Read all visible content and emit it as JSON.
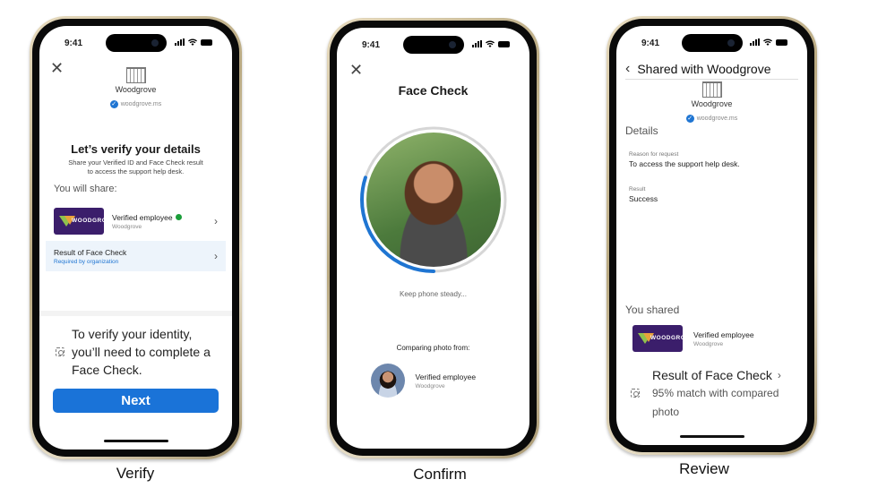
{
  "status_bar": {
    "time": "9:41"
  },
  "org": {
    "name": "Woodgrove",
    "domain": "woodgrove.ms",
    "card_text": "WOODGROVE"
  },
  "colors": {
    "accent": "#1a73d8",
    "progress": "#1f75d2",
    "card_bg": "#3b1e6b",
    "verified_green": "#1a9e3a",
    "highlight_row": "#edf4fb"
  },
  "steps": [
    {
      "label": "Verify"
    },
    {
      "label": "Confirm"
    },
    {
      "label": "Review"
    }
  ],
  "verify": {
    "close_icon": "close-icon",
    "title": "Let’s verify your details",
    "subtitle": "Share your Verified ID and Face Check result to access the support help desk.",
    "share_heading": "You will share:",
    "credential": {
      "name": "Verified employee",
      "issuer": "Woodgrove"
    },
    "face_check_row": {
      "title": "Result of Face Check",
      "subtitle": "Required by organization"
    },
    "sheet_message": "To verify your identity, you’ll need to complete a Face Check.",
    "next_label": "Next"
  },
  "confirm": {
    "title": "Face Check",
    "progress_fraction": 0.3,
    "status": "Keep phone steady...",
    "comparing_label": "Comparing photo from:",
    "credential": {
      "name": "Verified employee",
      "issuer": "Woodgrove"
    }
  },
  "review": {
    "back_icon": "chevron-left-icon",
    "title": "Shared with Woodgrove",
    "details_heading": "Details",
    "fields": [
      {
        "key": "Reason for request",
        "value": "To access the support help desk."
      },
      {
        "key": "Result",
        "value": "Success"
      }
    ],
    "shared_heading": "You shared",
    "credential": {
      "name": "Verified employee",
      "issuer": "Woodgrove"
    },
    "face_result": {
      "title": "Result of Face Check",
      "detail": "95% match with compared photo"
    }
  }
}
